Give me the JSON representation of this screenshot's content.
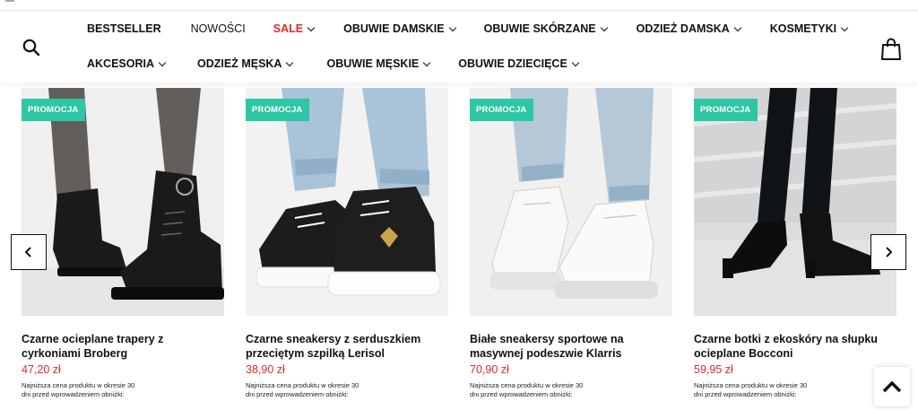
{
  "nav": {
    "row1": [
      {
        "label": "BESTSELLER",
        "has_dropdown": false,
        "style": "bold"
      },
      {
        "label": "NOWOŚCI",
        "has_dropdown": false,
        "style": "light"
      },
      {
        "label": "SALE",
        "has_dropdown": true,
        "style": "sale"
      },
      {
        "label": "OBUWIE DAMSKIE",
        "has_dropdown": true,
        "style": "bold"
      },
      {
        "label": "OBUWIE SKÓRZANE",
        "has_dropdown": true,
        "style": "bold"
      },
      {
        "label": "ODZIEŻ DAMSKA",
        "has_dropdown": true,
        "style": "bold"
      },
      {
        "label": "KOSMETYKI",
        "has_dropdown": true,
        "style": "bold"
      }
    ],
    "row2": [
      {
        "label": "AKCESORIA",
        "has_dropdown": true,
        "style": "bold"
      },
      {
        "label": "ODZIEŻ MĘSKA",
        "has_dropdown": true,
        "style": "bold"
      },
      {
        "label": "OBUWIE MĘSKIE",
        "has_dropdown": true,
        "style": "bold"
      },
      {
        "label": "OBUWIE DZIECIĘCE",
        "has_dropdown": true,
        "style": "bold"
      }
    ]
  },
  "icons": {
    "search": "search-icon",
    "cart": "shopping-bag-icon",
    "prev": "chevron-left-icon",
    "next": "chevron-right-icon",
    "scroll_top": "chevron-up-icon"
  },
  "colors": {
    "accent_badge": "#2dc7a5",
    "price": "#e3262b",
    "sale": "#e3262b"
  },
  "products": [
    {
      "badge": "PROMOCJA",
      "title": "Czarne ocieplane trapery z cyrkoniami Broberg",
      "price": "47,20 zł",
      "note": "Najniższa cena produktu w okresie 30 dni przed wprowadzeniem obniżki:"
    },
    {
      "badge": "PROMOCJA",
      "title": "Czarne sneakersy z serduszkiem przeciętym szpilką Lerisol",
      "price": "38,90 zł",
      "note": "Najniższa cena produktu w okresie 30 dni przed wprowadzeniem obniżki:"
    },
    {
      "badge": "PROMOCJA",
      "title": "Białe sneakersy sportowe na masywnej podeszwie Klarris",
      "price": "70,90 zł",
      "note": "Najniższa cena produktu w okresie 30 dni przed wprowadzeniem obniżki:"
    },
    {
      "badge": "PROMOCJA",
      "title": "Czarne botki z ekoskóry na słupku ocieplane Bocconi",
      "price": "59,95 zł",
      "note": "Najniższa cena produktu w okresie 30 dni przed wprowadzeniem obniżki:"
    }
  ]
}
